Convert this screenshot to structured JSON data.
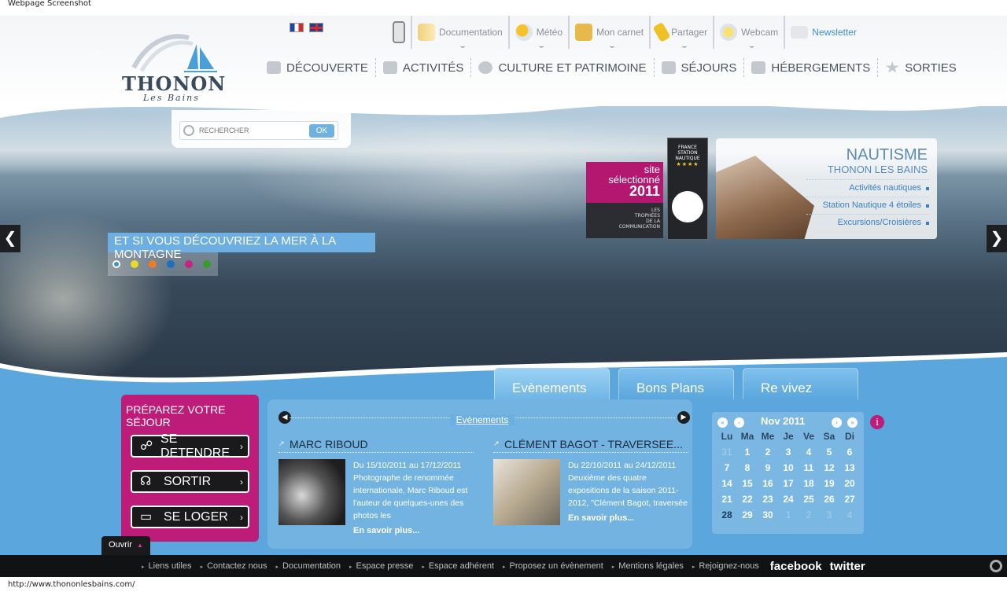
{
  "browser": {
    "title": "Webpage Screenshot",
    "status_url": "http://www.thononlesbains.com/"
  },
  "logo": {
    "name": "THONON",
    "tagline": "Les Bains"
  },
  "languages": [
    {
      "code": "fr"
    },
    {
      "code": "en"
    }
  ],
  "tools": [
    {
      "label": "",
      "icon": "mobile-icon"
    },
    {
      "label": "Documentation",
      "icon": "document-icon"
    },
    {
      "label": "Météo",
      "icon": "weather-icon"
    },
    {
      "label": "Mon carnet",
      "icon": "notebook-icon"
    },
    {
      "label": "Partager",
      "icon": "share-icon"
    },
    {
      "label": "Webcam",
      "icon": "webcam-icon"
    },
    {
      "label": "Newsletter",
      "icon": "envelope-icon"
    }
  ],
  "nav": [
    {
      "label": "Découverte",
      "icon": "camera-icon"
    },
    {
      "label": "Activités",
      "icon": "activity-icon"
    },
    {
      "label": "Culture et patrimoine",
      "icon": "culture-icon"
    },
    {
      "label": "Séjours",
      "icon": "suitcase-icon"
    },
    {
      "label": "Hébergements",
      "icon": "house-icon"
    },
    {
      "label": "Sorties",
      "icon": "star-icon"
    }
  ],
  "search": {
    "placeholder": "RECHERCHER",
    "button": "OK"
  },
  "award": {
    "line1": "site",
    "line2": "sélectionné",
    "year": "2011",
    "sub1": "LES",
    "sub2": "TROPHÉES",
    "sub3": "DE LA",
    "sub4": "COMMUNICATION"
  },
  "station": {
    "line1": "FRANCE",
    "line2": "STATION",
    "line3": "NAUTIQUE",
    "stars": "★★★★"
  },
  "nautisme": {
    "title": "Nautisme",
    "subtitle": "Thonon les Bains",
    "links": [
      "Activités nautiques",
      "Station Nautique 4 étoiles",
      "Excursions/Croisières"
    ]
  },
  "slider": {
    "caption": "Et si vous découvriez la mer à la montagne",
    "prev": "❮",
    "next": "❯",
    "dots": [
      "#3f8fd8",
      "#e8d82a",
      "#ef7b27",
      "#1f6fc0",
      "#c8247f",
      "#3a9a2a"
    ]
  },
  "tabs": [
    "Evènements",
    "Bons Plans",
    "Re vivez"
  ],
  "prepare": {
    "title": "Préparez votre séjour",
    "buttons": [
      {
        "label": "SE DETENDRE",
        "icon": "relax-icon"
      },
      {
        "label": "SORTIR",
        "icon": "outing-icon"
      },
      {
        "label": "SE LOGER",
        "icon": "bed-icon"
      }
    ],
    "ouvrir": "Ouvrir"
  },
  "events": {
    "header": "Evènements",
    "items": [
      {
        "title": "MARC RIBOUD",
        "dates": "Du 15/10/2011 au 17/12/2011",
        "text": "Photographe de renommée internationale, Marc Riboud est l'auteur de quelques-unes des photos les",
        "more": "En savoir plus..."
      },
      {
        "title": "CLÉMENT BAGOT - TRAVERSEE...",
        "dates": "Du 22/10/2011 au 24/12/2011",
        "text": "Deuxième des quatre expositions de la saison 2011-2012, \"Clément Bagot, traversée",
        "more": "En savoir plus..."
      }
    ]
  },
  "calendar": {
    "month": "Nov 2011",
    "dow": [
      "Lu",
      "Ma",
      "Me",
      "Je",
      "Ve",
      "Sa",
      "Di"
    ],
    "weeks": [
      [
        "31",
        "1",
        "2",
        "3",
        "4",
        "5",
        "6"
      ],
      [
        "7",
        "8",
        "9",
        "10",
        "11",
        "12",
        "13"
      ],
      [
        "14",
        "15",
        "16",
        "17",
        "18",
        "19",
        "20"
      ],
      [
        "21",
        "22",
        "23",
        "24",
        "25",
        "26",
        "27"
      ],
      [
        "28",
        "29",
        "30",
        "1",
        "2",
        "3",
        "4"
      ]
    ]
  },
  "footer": {
    "links": [
      "Liens utiles",
      "Contactez nous",
      "Documentation",
      "Espace presse",
      "Espace adhérent",
      "Proposez un évènement",
      "Mentions légales",
      "Rejoignez-nous"
    ],
    "facebook": "facebook",
    "twitter": "twitter"
  }
}
